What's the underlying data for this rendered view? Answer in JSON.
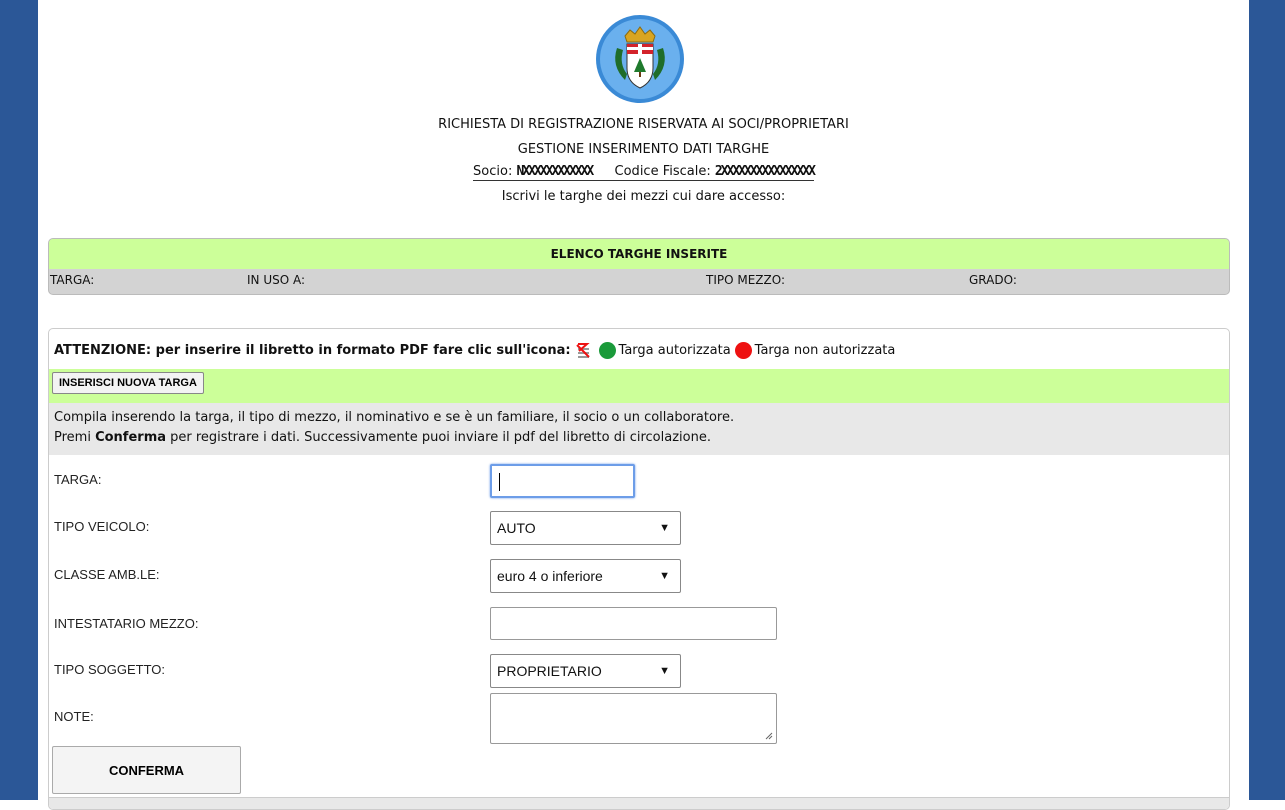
{
  "header": {
    "title": "RICHIESTA DI REGISTRAZIONE RISERVATA AI SOCI/PROPRIETARI",
    "subtitle": "GESTIONE INSERIMENTO DATI TARGHE",
    "socio_label": "Socio:",
    "socio_value": "NXXXXXXXXXXXX",
    "cf_label": "Codice Fiscale:",
    "cf_value": "2XXXXXXXXXXXXXXXX",
    "instruction": "Iscrivi le targhe dei mezzi cui dare accesso:"
  },
  "list": {
    "title": "ELENCO TARGHE INSERITE",
    "columns": [
      "TARGA:",
      "IN USO A:",
      "TIPO MEZZO:",
      "GRADO:"
    ]
  },
  "notice": {
    "bold_text": "ATTENZIONE: per inserire il libretto in formato PDF fare clic sull'icona:",
    "authorized": "Targa autorizzata",
    "not_authorized": "Targa non autorizzata"
  },
  "new_plate_button": "INSERISCI NUOVA TARGA",
  "info": {
    "line1": "Compila inserendo la targa, il tipo di mezzo, il nominativo e se è un familiare, il socio o un collaboratore.",
    "line2_pre": "Premi ",
    "line2_bold": "Conferma",
    "line2_post": " per registrare i dati. Successivamente puoi inviare il pdf del libretto di circolazione."
  },
  "form": {
    "targa_label": "TARGA:",
    "targa_value": "",
    "tipo_veicolo_label": "TIPO VEICOLO:",
    "tipo_veicolo_value": "AUTO",
    "classe_label": "CLASSE AMB.LE:",
    "classe_value": "euro 4 o inferiore",
    "intestatario_label": "INTESTATARIO MEZZO:",
    "intestatario_value": "",
    "tipo_soggetto_label": "TIPO SOGGETTO:",
    "tipo_soggetto_value": "PROPRIETARIO",
    "note_label": "NOTE:",
    "note_value": ""
  },
  "confirm_button": "CONFERMA",
  "colors": {
    "side_bars": "#2b5797",
    "green_header": "#ccff99",
    "grey_row": "#d3d3d3",
    "authorized_dot": "#1a9a3a",
    "not_authorized_dot": "#ee1111"
  }
}
